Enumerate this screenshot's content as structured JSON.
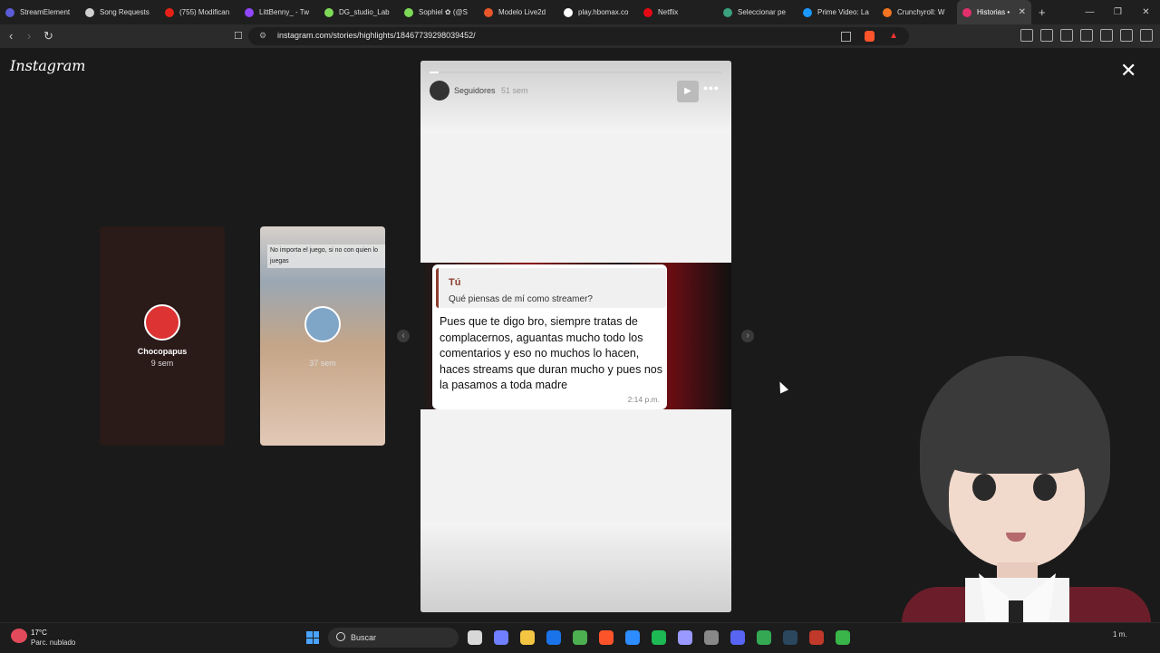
{
  "browser": {
    "tabs": [
      {
        "label": "StreamElement",
        "color": "#5b5bd6",
        "width": 88
      },
      {
        "label": "Song Requests",
        "color": "#cfcfcf",
        "width": 88
      },
      {
        "label": "(755) Modifican",
        "color": "#e62117",
        "width": 88
      },
      {
        "label": "LittBenny_ - Tw",
        "color": "#9146ff",
        "width": 88
      },
      {
        "label": "DG_studio_Lab",
        "color": "#7ed957",
        "width": 88
      },
      {
        "label": "Sophiel ✿ (@S",
        "color": "#7ed957",
        "width": 88
      },
      {
        "label": "Modelo Live2d",
        "color": "#e8562a",
        "width": 88
      },
      {
        "label": "play.hbomax.co",
        "color": "#ffffff",
        "width": 88
      },
      {
        "label": "Netflix",
        "color": "#e50914",
        "width": 88
      },
      {
        "label": "Seleccionar pe",
        "color": "#3aa17e",
        "width": 88
      },
      {
        "label": "Prime Video: La",
        "color": "#1a98ff",
        "width": 88
      },
      {
        "label": "Crunchyroll: W",
        "color": "#f47521",
        "width": 88
      },
      {
        "label": "Historias •",
        "color": "#e1306c",
        "width": 82,
        "active": true
      }
    ],
    "new_tab": "+",
    "window_controls": [
      "—",
      "❐",
      "✕"
    ],
    "url": "instagram.com/stories/highlights/18467739298039452/"
  },
  "instagram": {
    "logo": "Instagram",
    "close": "✕",
    "previews": [
      {
        "name": "Chocopapus",
        "time": "9 sem"
      },
      {
        "caption": "No importa el juego, si no con quien lo juegas",
        "time": "37 sem"
      }
    ],
    "prev_arrow": "‹",
    "next_arrow": "›",
    "story": {
      "progress": 0.03,
      "user": "Seguidores",
      "time": "51 sem",
      "play": "▶",
      "more": "•••",
      "quote_name": "Tú",
      "quote_text": "Qué piensas de mí como streamer?",
      "message": "Pues que te digo bro, siempre tratas de complacernos, aguantas mucho todo los comentarios y eso no muchos lo hacen, haces streams que duran mucho y pues nos la pasamos a toda madre",
      "message_time": "2:14 p.m."
    }
  },
  "taskbar": {
    "temp": "17°C",
    "weather": "Parc. nublado",
    "search": "Buscar",
    "icons": [
      "#d8d8d8",
      "#6f7fff",
      "#f4c542",
      "#1a73e8",
      "#4cb050",
      "#fb542b",
      "#2d8cff",
      "#1db954",
      "#9999ff",
      "#888888",
      "#5865f2",
      "#34a853",
      "#2a475e",
      "#c0392b",
      "#39b54a"
    ],
    "tray": "1 m."
  }
}
